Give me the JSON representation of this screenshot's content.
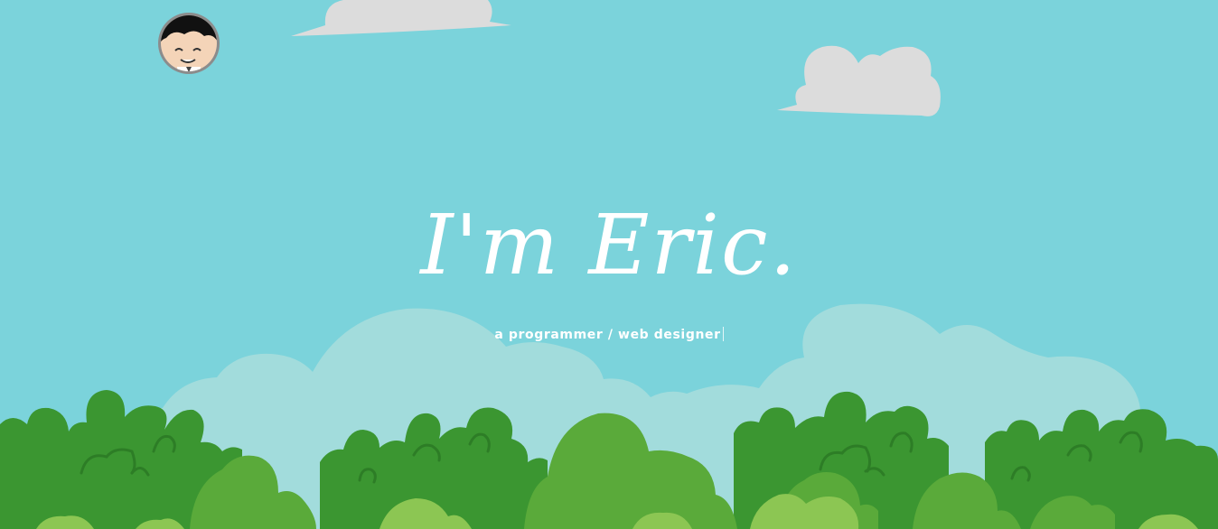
{
  "hero": {
    "headline": "I'm Eric.",
    "subtitle": "a programmer / web designer"
  },
  "avatar": {
    "description": "cartoon boy avatar"
  },
  "colors": {
    "sky": "#7bd3db",
    "cloud": "#dcdcdc",
    "background_cloud": "#a2dcdc",
    "bush_dark": "#3b9631",
    "bush_mid": "#5aaa3a",
    "bush_light": "#8cc653",
    "text": "#ffffff"
  }
}
